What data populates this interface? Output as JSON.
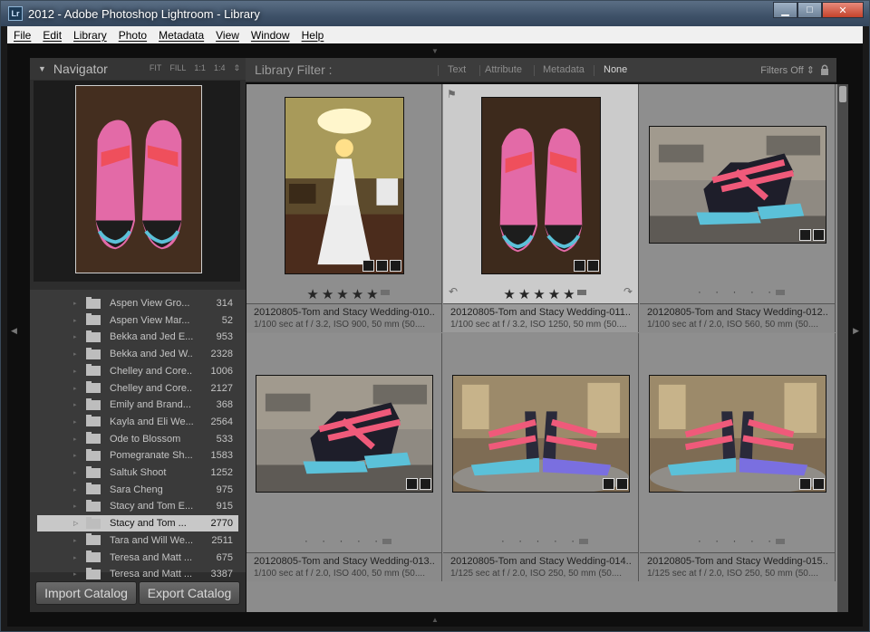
{
  "window": {
    "app_icon": "Lr",
    "title": "2012 - Adobe Photoshop Lightroom - Library",
    "minimize": "▁",
    "maximize": "□",
    "close": "✕"
  },
  "menu": [
    "File",
    "Edit",
    "Library",
    "Photo",
    "Metadata",
    "View",
    "Window",
    "Help"
  ],
  "navigator": {
    "title": "Navigator",
    "zoom_options": [
      "FIT",
      "FILL",
      "1:1",
      "1:4"
    ]
  },
  "folders": [
    {
      "name": "Aspen View Gro...",
      "count": "314"
    },
    {
      "name": "Aspen View Mar...",
      "count": "52"
    },
    {
      "name": "Bekka and Jed E...",
      "count": "953"
    },
    {
      "name": "Bekka and Jed W...",
      "count": "2328"
    },
    {
      "name": "Chelley and Core...",
      "count": "1006"
    },
    {
      "name": "Chelley and Core...",
      "count": "2127"
    },
    {
      "name": "Emily and Brand...",
      "count": "368"
    },
    {
      "name": "Kayla and Eli We...",
      "count": "2564"
    },
    {
      "name": "Ode to Blossom",
      "count": "533"
    },
    {
      "name": "Pomegranate Sh...",
      "count": "1583"
    },
    {
      "name": "Saltuk Shoot",
      "count": "1252"
    },
    {
      "name": "Sara Cheng",
      "count": "975"
    },
    {
      "name": "Stacy and Tom E...",
      "count": "915"
    },
    {
      "name": "Stacy and Tom ...",
      "count": "2770",
      "selected": true
    },
    {
      "name": "Tara and Will We...",
      "count": "2511"
    },
    {
      "name": "Teresa and Matt ...",
      "count": "675"
    },
    {
      "name": "Teresa and Matt ...",
      "count": "3387"
    }
  ],
  "buttons": {
    "import": "Import Catalog",
    "export": "Export Catalog"
  },
  "filter": {
    "label": "Library Filter :",
    "options": [
      "Text",
      "Attribute",
      "Metadata",
      "None"
    ],
    "active": "None",
    "status": "Filters Off"
  },
  "grid": [
    {
      "file": "20120805-Tom and Stacy Wedding-010....",
      "exif": "1/100 sec at f / 3.2, ISO 900, 50 mm (50....",
      "rating": "★★★★★",
      "selected": false
    },
    {
      "file": "20120805-Tom and Stacy Wedding-011....",
      "exif": "1/100 sec at f / 3.2, ISO 1250, 50 mm (50....",
      "rating": "★★★★★",
      "selected": true
    },
    {
      "file": "20120805-Tom and Stacy Wedding-012....",
      "exif": "1/100 sec at f / 2.0, ISO 560, 50 mm (50....",
      "rating": "· · · · ·",
      "selected": false
    },
    {
      "file": "20120805-Tom and Stacy Wedding-013....",
      "exif": "1/100 sec at f / 2.0, ISO 400, 50 mm (50....",
      "rating": "· · · · ·",
      "selected": false
    },
    {
      "file": "20120805-Tom and Stacy Wedding-014....",
      "exif": "1/125 sec at f / 2.0, ISO 250, 50 mm (50....",
      "rating": "· · · · ·",
      "selected": false
    },
    {
      "file": "20120805-Tom and Stacy Wedding-015....",
      "exif": "1/125 sec at f / 2.0, ISO 250, 50 mm (50....",
      "rating": "· · · · ·",
      "selected": false
    }
  ],
  "colors": {
    "titlebar": "#3e5168",
    "panel": "#2d2d2d",
    "grid_bg": "#8c8c8c",
    "selected_cell": "#cbcbcb"
  }
}
